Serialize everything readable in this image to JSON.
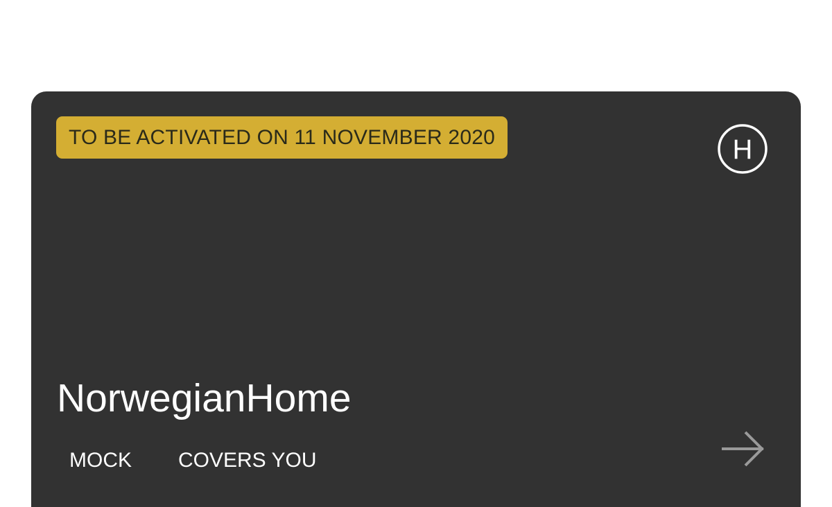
{
  "card": {
    "status_badge": "TO BE ACTIVATED ON 11 NOVEMBER 2020",
    "logo_letter": "H",
    "title": "NorwegianHome",
    "tags": [
      "MOCK",
      "COVERS YOU"
    ],
    "arrow_icon": "arrow-right-icon",
    "logo_icon": "circle-h-logo-icon",
    "colors": {
      "card_background": "#323232",
      "badge_background": "#d4ae33",
      "badge_text": "#2a2a1a",
      "text": "#ffffff",
      "arrow": "#9a9a9a"
    }
  }
}
